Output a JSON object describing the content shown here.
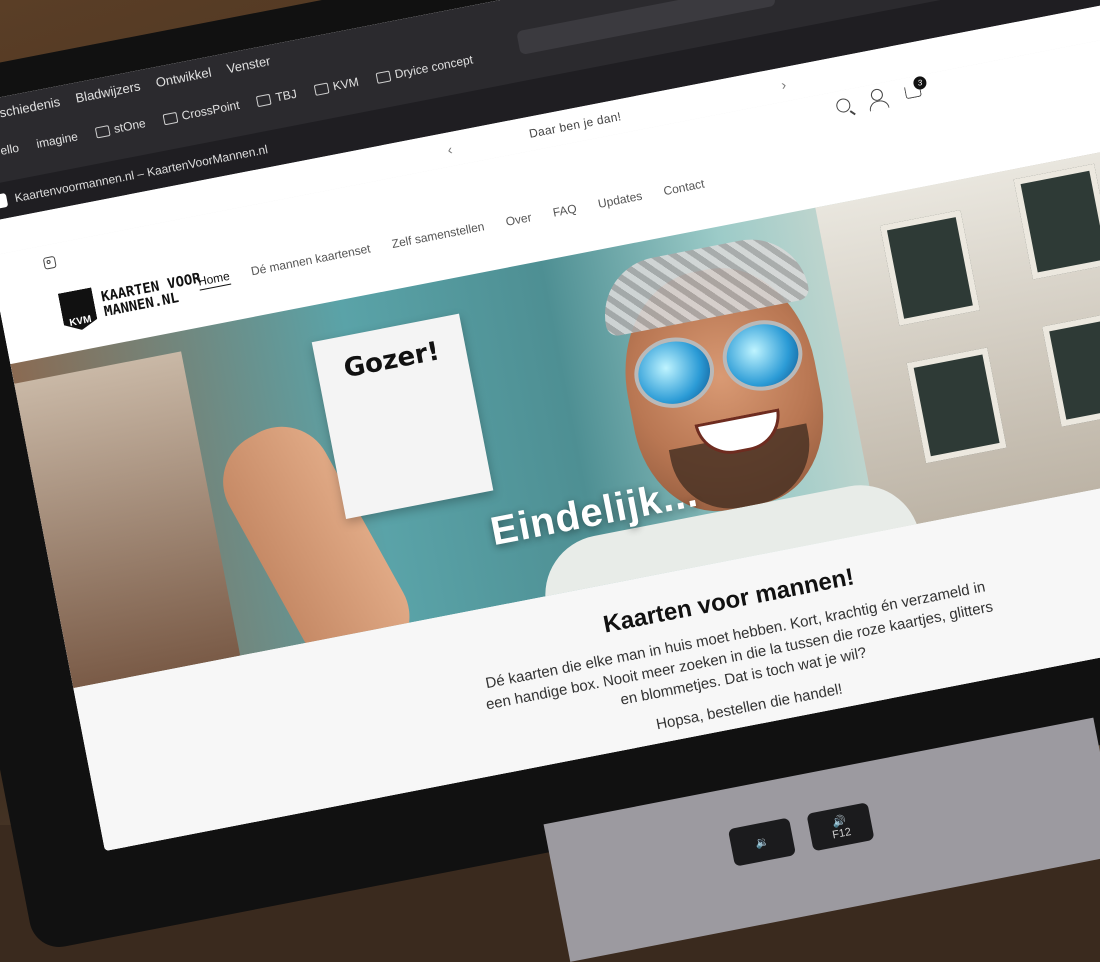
{
  "browser": {
    "menu": [
      "Geschiedenis",
      "Bladwijzers",
      "Ontwikkel",
      "Venster"
    ],
    "favorites": [
      "Trello",
      "imagine",
      "stOne",
      "CrossPoint",
      "TBJ",
      "KVM",
      "Dryice concept"
    ],
    "tab_title": "Kaartenvoormannen.nl – KaartenVoorMannen.nl"
  },
  "announcement": {
    "text": "Daar ben je dan!"
  },
  "header": {
    "logo_mark": "KVM",
    "logo_line1": "KAARTEN VOOR",
    "logo_line2": "MANNEN.NL",
    "cart_count": "3"
  },
  "nav": [
    "Home",
    "Dé mannen kaartenset",
    "Zelf samenstellen",
    "Over",
    "FAQ",
    "Updates",
    "Contact"
  ],
  "hero": {
    "card_text": "Gozer!",
    "heading": "Eindelijk..."
  },
  "content": {
    "title": "Kaarten voor mannen!",
    "body": "Dé kaarten die elke man in huis moet hebben. Kort, krachtig én verzameld in een handige box. Nooit meer zoeken in die la tussen die roze kaartjes, glitters en blommetjes. Dat is toch wat je wil?",
    "cta": "Hopsa, bestellen die handel!"
  },
  "keyboard": {
    "key_vol_down": "🔉",
    "key_vol_up": "🔊",
    "key_f12": "F12"
  }
}
